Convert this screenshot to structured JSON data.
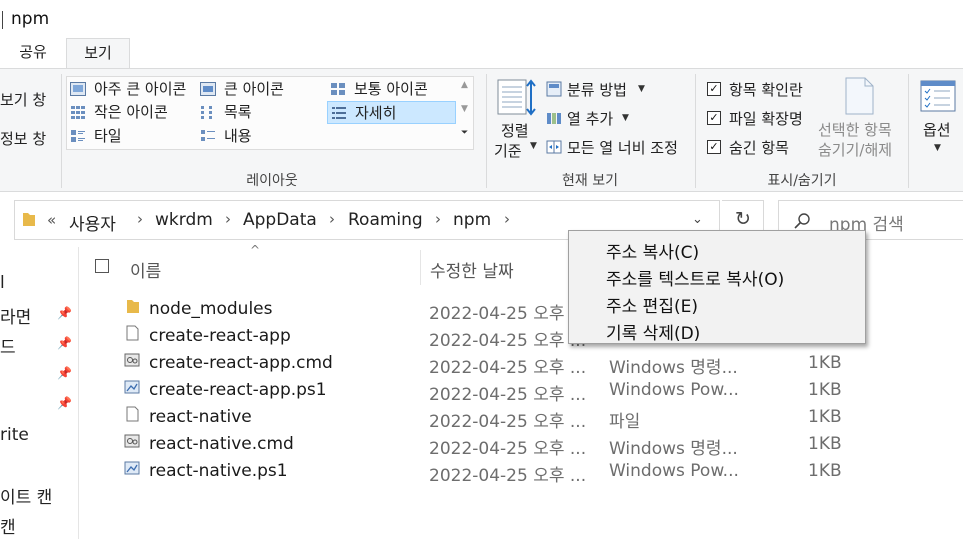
{
  "window": {
    "title": "npm"
  },
  "tabs": [
    {
      "label": "공유"
    },
    {
      "label": "보기"
    }
  ],
  "ribbon": {
    "pane": {
      "preview": "보기 창",
      "details": "정보 창"
    },
    "layout": {
      "items": [
        "아주 큰 아이콘",
        "큰 아이콘",
        "보통 아이콘",
        "작은 아이콘",
        "목록",
        "자세히",
        "타일",
        "내용"
      ],
      "group_label": "레이아웃"
    },
    "current_view": {
      "sort_label_1": "정렬",
      "sort_label_2": "기준",
      "group_by": "분류 방법",
      "add_columns": "열 추가",
      "size_all_columns": "모든 열 너비 조정",
      "group_label": "현재 보기"
    },
    "show_hide": {
      "item_checkboxes": "항목 확인란",
      "file_extensions": "파일 확장명",
      "hidden_items": "숨긴 항목",
      "hide_selected_1": "선택한 항목",
      "hide_selected_2": "숨기기/해제",
      "group_label": "표시/숨기기"
    },
    "options": {
      "label": "옵션"
    }
  },
  "address": {
    "overflow": "«",
    "crumbs": [
      "사용자",
      "wkrdm",
      "AppData",
      "Roaming",
      "npm"
    ],
    "search_placeholder": "npm 검색"
  },
  "nav": {
    "items": [
      "l",
      "라면",
      "드",
      "",
      "",
      "rite",
      "",
      "이트 캔",
      "캔"
    ]
  },
  "columns": {
    "name": "이름",
    "date": "수정한 날짜"
  },
  "files": [
    {
      "name": "node_modules",
      "date": "2022-04-25 오후 ...",
      "type": "",
      "size": "",
      "icon": "folder-icon"
    },
    {
      "name": "create-react-app",
      "date": "2022-04-25 오후 ...",
      "type": "",
      "size": "",
      "icon": "file-icon"
    },
    {
      "name": "create-react-app.cmd",
      "date": "2022-04-25 오후 ...",
      "type": "Windows 명령...",
      "size": "1KB",
      "icon": "cmd-file-icon"
    },
    {
      "name": "create-react-app.ps1",
      "date": "2022-04-25 오후 ...",
      "type": "Windows Pow...",
      "size": "1KB",
      "icon": "ps1-file-icon"
    },
    {
      "name": "react-native",
      "date": "2022-04-25 오후 ...",
      "type": "파일",
      "size": "1KB",
      "icon": "file-icon"
    },
    {
      "name": "react-native.cmd",
      "date": "2022-04-25 오후 ...",
      "type": "Windows 명령...",
      "size": "1KB",
      "icon": "cmd-file-icon"
    },
    {
      "name": "react-native.ps1",
      "date": "2022-04-25 오후 ...",
      "type": "Windows Pow...",
      "size": "1KB",
      "icon": "ps1-file-icon"
    }
  ],
  "context_menu": {
    "items": [
      "주소 복사(C)",
      "주소를 텍스트로 복사(O)",
      "주소 편집(E)",
      "기록 삭제(D)"
    ]
  },
  "colors": {
    "selection": "#cce8ff",
    "folder": "#e8b94a",
    "ribbon_bg": "#f5f6f7"
  }
}
